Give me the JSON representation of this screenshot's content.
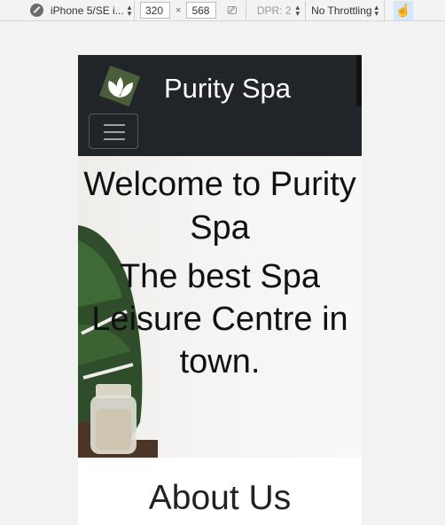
{
  "devtools": {
    "device": "iPhone 5/SE i...",
    "width": "320",
    "times": "×",
    "height": "568",
    "dpr": "DPR: 2",
    "throttling": "No Throttling"
  },
  "site": {
    "brand": "Purity Spa",
    "hero_title": "Welcome to Purity Spa",
    "hero_subtitle": "The best Spa Leisure Centre in town.",
    "about_heading": "About Us"
  },
  "colors": {
    "navbar_bg": "#212529",
    "logo_green": "#4a5e3a"
  }
}
